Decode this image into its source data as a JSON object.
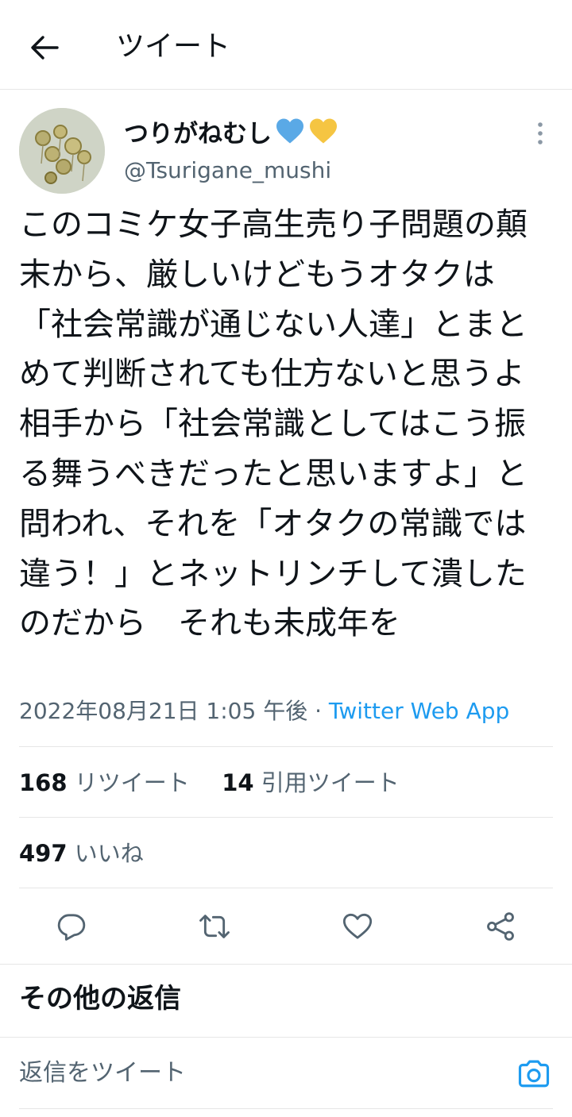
{
  "header": {
    "title": "ツイート",
    "back_icon": "arrow-left-icon"
  },
  "tweet": {
    "display_name": "つりがねむし",
    "handle": "@Tsurigane_mushi",
    "text": "このコミケ女子高生売り子問題の顛末から、厳しいけどもうオタクは「社会常識が通じない人達」とまとめて判断されても仕方ないと思うよ　相手から「社会常識としてはこう振る舞うべきだったと思いますよ」と問われ、それを「オタクの常識では違う！」とネットリンチして潰したのだから　それも未成年を",
    "timestamp": "2022年08月21日 1:05 午後",
    "separator": " · ",
    "source_app": "Twitter Web App",
    "hearts": {
      "first_color": "#5aa9e6",
      "second_color": "#f5c542"
    }
  },
  "stats": {
    "retweets_count": "168",
    "retweets_label": "リツイート",
    "quotes_count": "14",
    "quotes_label": "引用ツイート",
    "likes_count": "497",
    "likes_label": "いいね"
  },
  "actions": {
    "icons": [
      "reply-icon",
      "retweet-icon",
      "like-icon",
      "share-icon"
    ]
  },
  "replies": {
    "heading": "その他の返信"
  },
  "composer": {
    "placeholder": "返信をツイート",
    "accent": "#1d9bf0"
  },
  "colors": {
    "text": "#0f1419",
    "secondary": "#536471",
    "link": "#1d9bf0",
    "divider": "#e6e6e6"
  }
}
